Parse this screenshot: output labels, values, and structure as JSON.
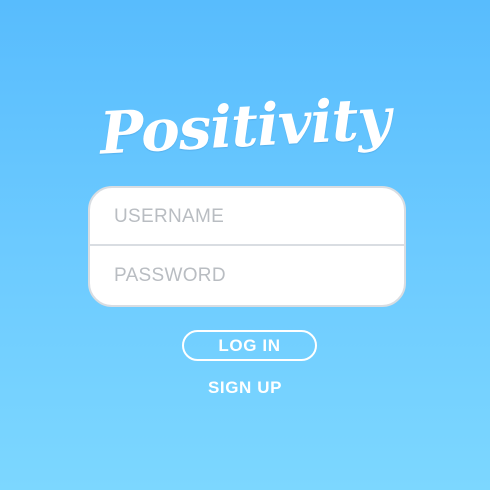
{
  "app": {
    "title": "Positivity"
  },
  "login_form": {
    "username_placeholder": "USERNAME",
    "password_placeholder": "PASSWORD",
    "username_value": "",
    "password_value": ""
  },
  "actions": {
    "login_label": "LOG IN",
    "signup_label": "SIGN UP"
  },
  "colors": {
    "background_top": "#58bcfd",
    "background_bottom": "#7cd7ff",
    "card": "#ffffff",
    "card_border": "#d9dde2",
    "placeholder": "#b9bdc2",
    "text_on_background": "#ffffff"
  }
}
